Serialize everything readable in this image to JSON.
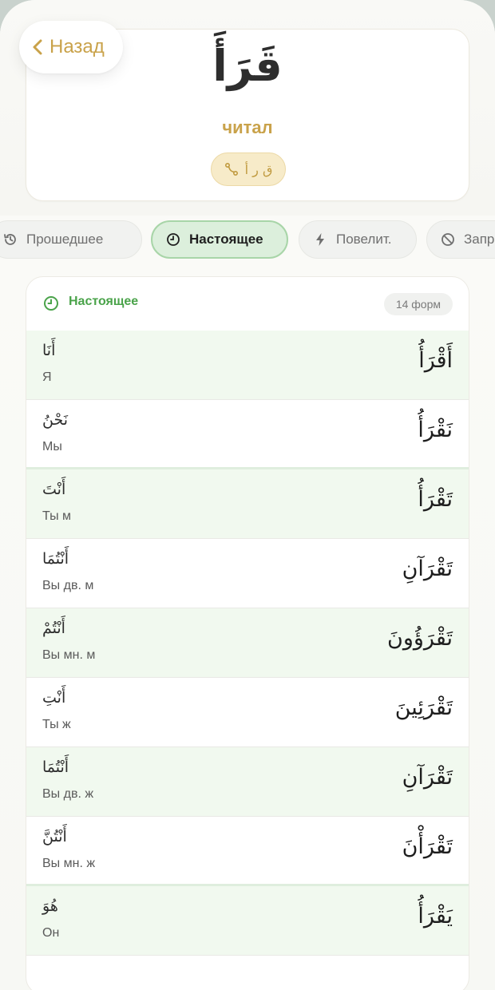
{
  "header": {
    "back_label": "Назад",
    "word": "قَرَأَ",
    "translation": "читал",
    "root": "ق ر أ"
  },
  "tabs": [
    {
      "label": "Прошедшее",
      "icon": "history-icon",
      "active": false
    },
    {
      "label": "Настоящее",
      "icon": "clock-icon",
      "active": true
    },
    {
      "label": "Повелит.",
      "icon": "lightning-icon",
      "active": false
    },
    {
      "label": "Запр",
      "icon": "prohibit-icon",
      "active": false
    }
  ],
  "section": {
    "title": "Настоящее",
    "count": "14 форм",
    "rows": [
      {
        "pronoun_ar": "أَنَا",
        "pronoun_ru": "Я",
        "form": "أَقْرَأُ"
      },
      {
        "pronoun_ar": "نَحْنُ",
        "pronoun_ru": "Мы",
        "form": "نَقْرَأُ"
      },
      {
        "pronoun_ar": "أَنْتَ",
        "pronoun_ru": "Ты м",
        "form": "تَقْرَأُ"
      },
      {
        "pronoun_ar": "أَنْتُمَا",
        "pronoun_ru": "Вы дв. м",
        "form": "تَقْرَآنِ"
      },
      {
        "pronoun_ar": "أَنْتُمْ",
        "pronoun_ru": "Вы мн. м",
        "form": "تَقْرَؤُونَ"
      },
      {
        "pronoun_ar": "أَنْتِ",
        "pronoun_ru": "Ты ж",
        "form": "تَقْرَئِينَ"
      },
      {
        "pronoun_ar": "أَنْتُمَا",
        "pronoun_ru": "Вы дв. ж",
        "form": "تَقْرَآنِ"
      },
      {
        "pronoun_ar": "أَنْتُنَّ",
        "pronoun_ru": "Вы мн. ж",
        "form": "تَقْرَأْنَ"
      },
      {
        "pronoun_ar": "هُوَ",
        "pronoun_ru": "Он",
        "form": "يَقْرَأُ"
      }
    ]
  },
  "colors": {
    "accent_gold": "#c9a24a",
    "accent_green": "#4aa34a",
    "active_tab_bg": "#dcefdc"
  }
}
